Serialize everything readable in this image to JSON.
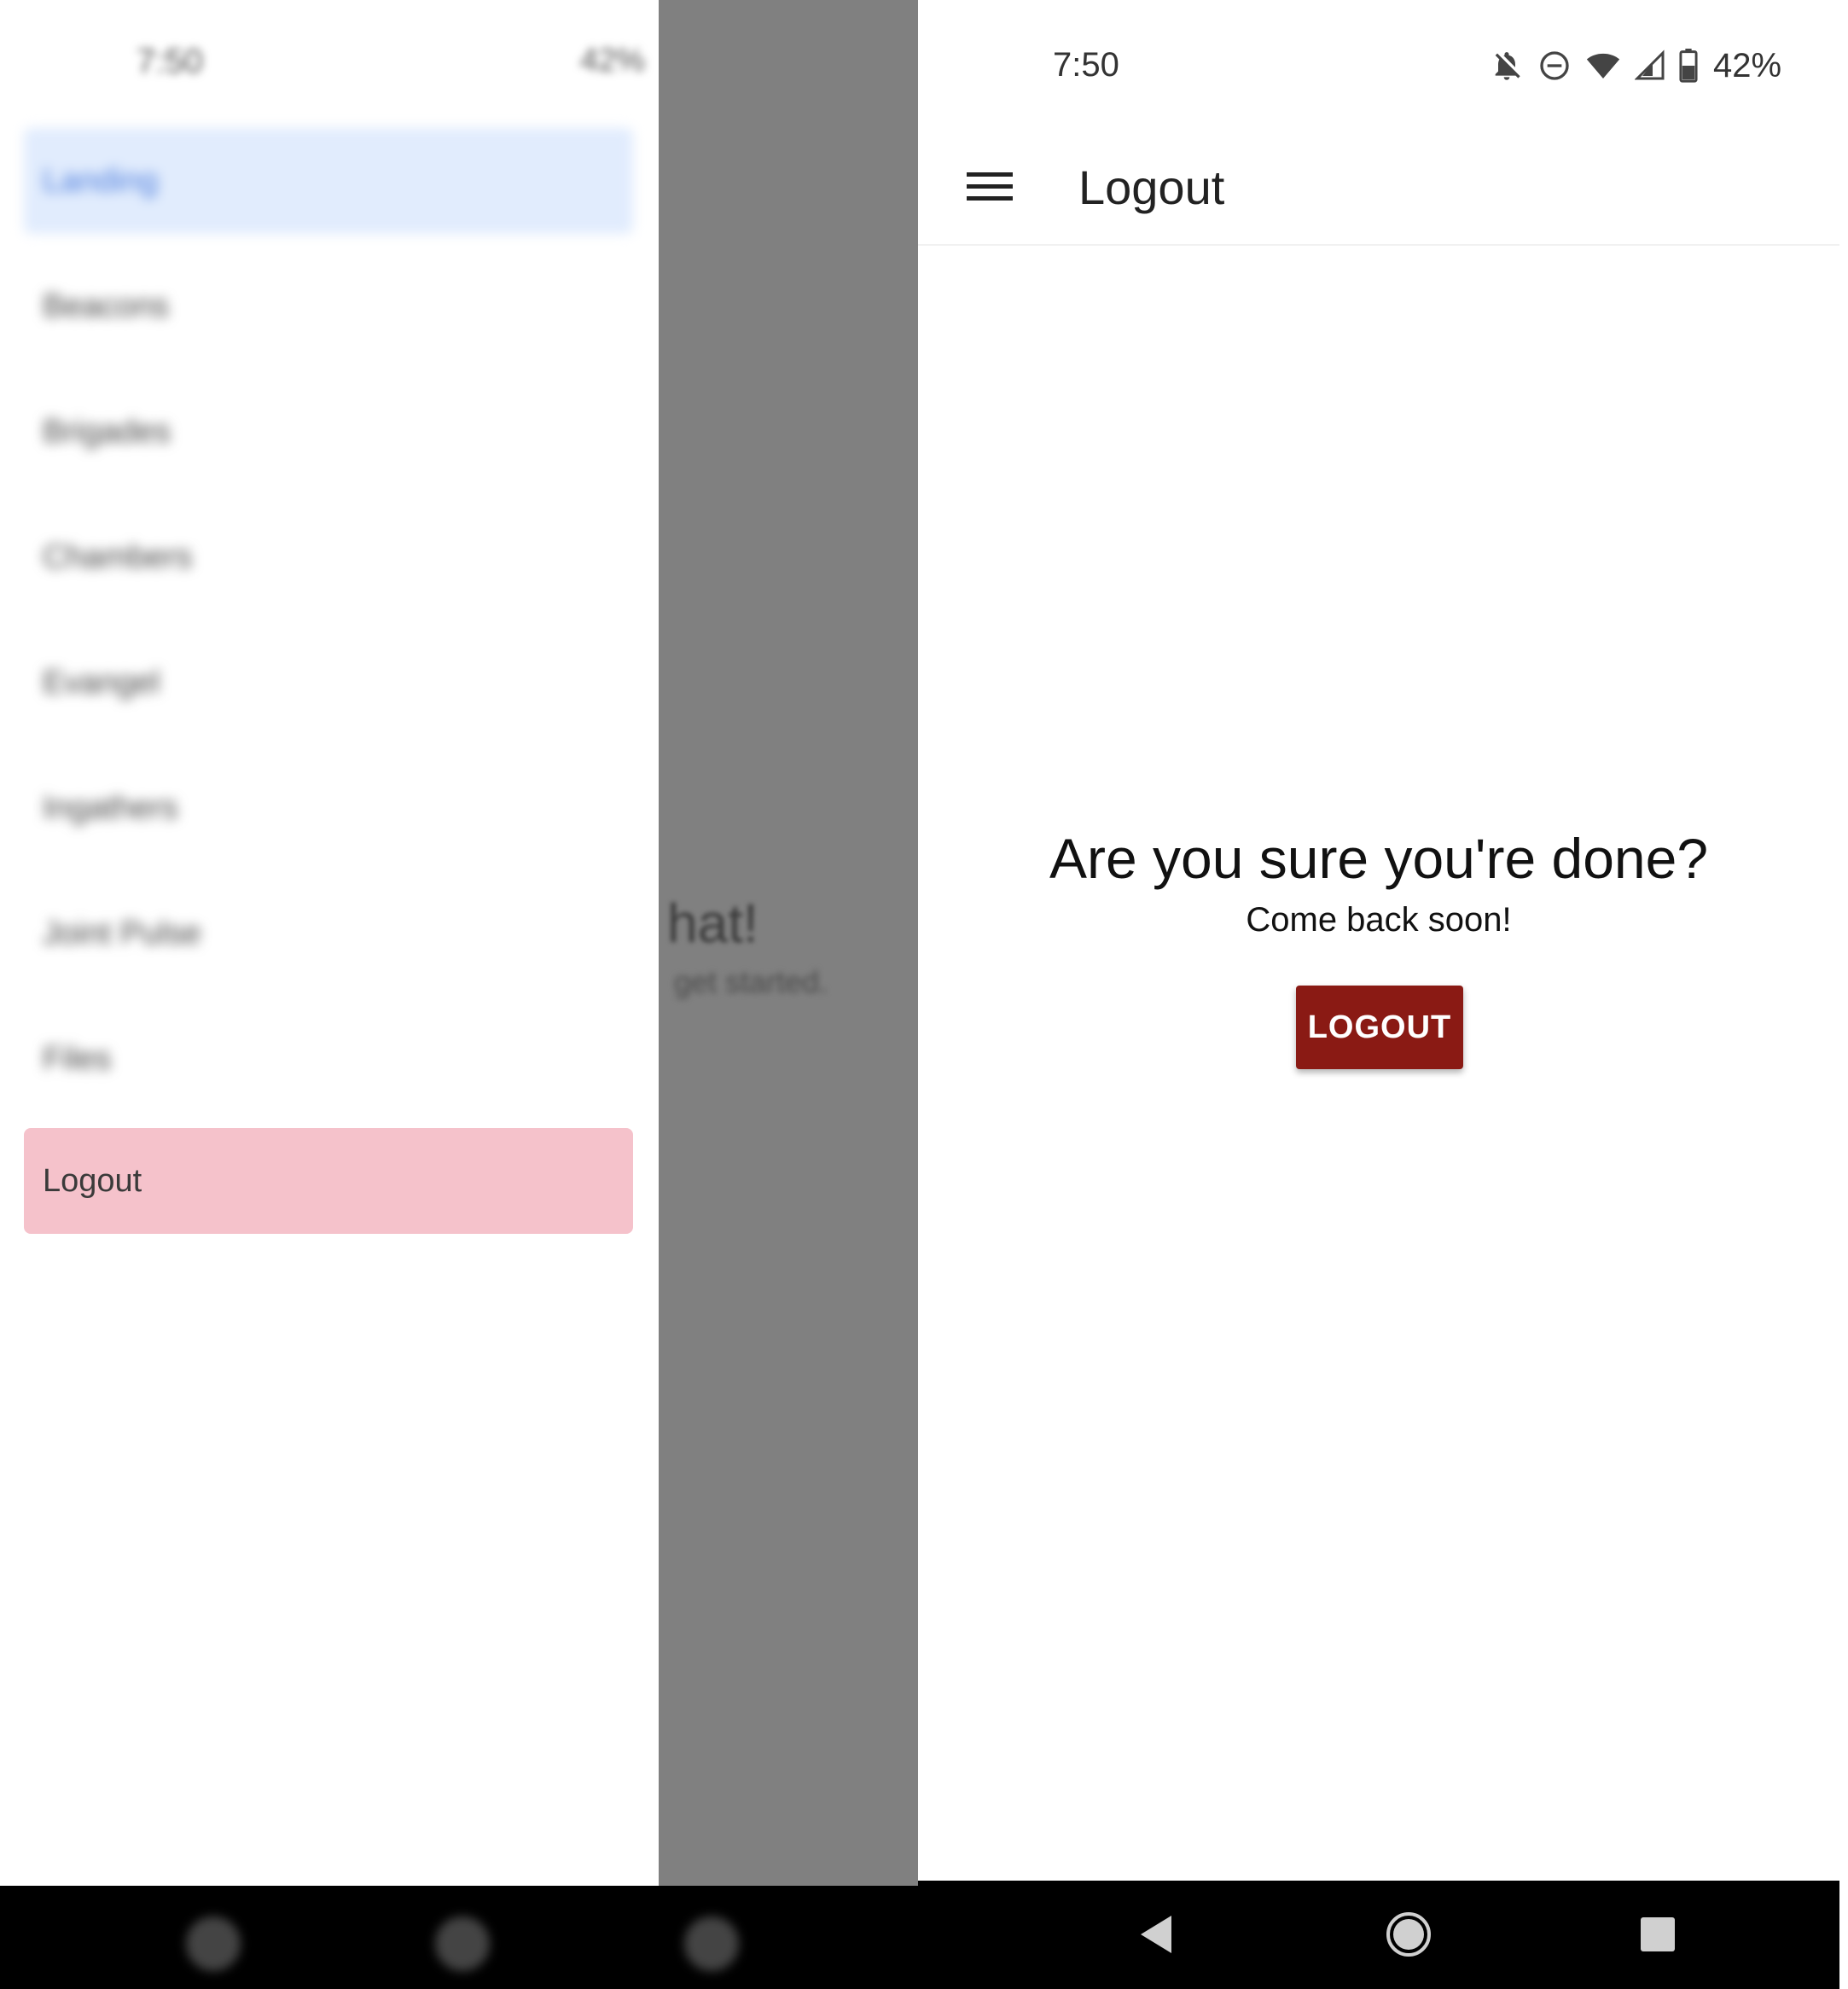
{
  "drawer": {
    "items": [
      {
        "label": "Landing"
      },
      {
        "label": "Beacons"
      },
      {
        "label": "Brigades"
      },
      {
        "label": "Chambers"
      },
      {
        "label": "Evangel"
      },
      {
        "label": "Ingathers"
      },
      {
        "label": "Joint Pulse"
      },
      {
        "label": "Files"
      },
      {
        "label": "Logout"
      }
    ],
    "background_text_1": "hat!",
    "background_text_2": "get started."
  },
  "status": {
    "time": "7:50",
    "battery": "42%",
    "icons": [
      "notifications-off-icon",
      "do-not-disturb-icon",
      "wifi-icon",
      "signal-icon",
      "battery-icon"
    ]
  },
  "appbar": {
    "title": "Logout"
  },
  "main": {
    "question": "Are you sure you're done?",
    "subtext": "Come back soon!",
    "logout_button": "LOGOUT"
  },
  "colors": {
    "logout_button": "#8a1a14",
    "drawer_active": "#e1ecfd",
    "drawer_logout_highlight": "#f5c2cb"
  }
}
